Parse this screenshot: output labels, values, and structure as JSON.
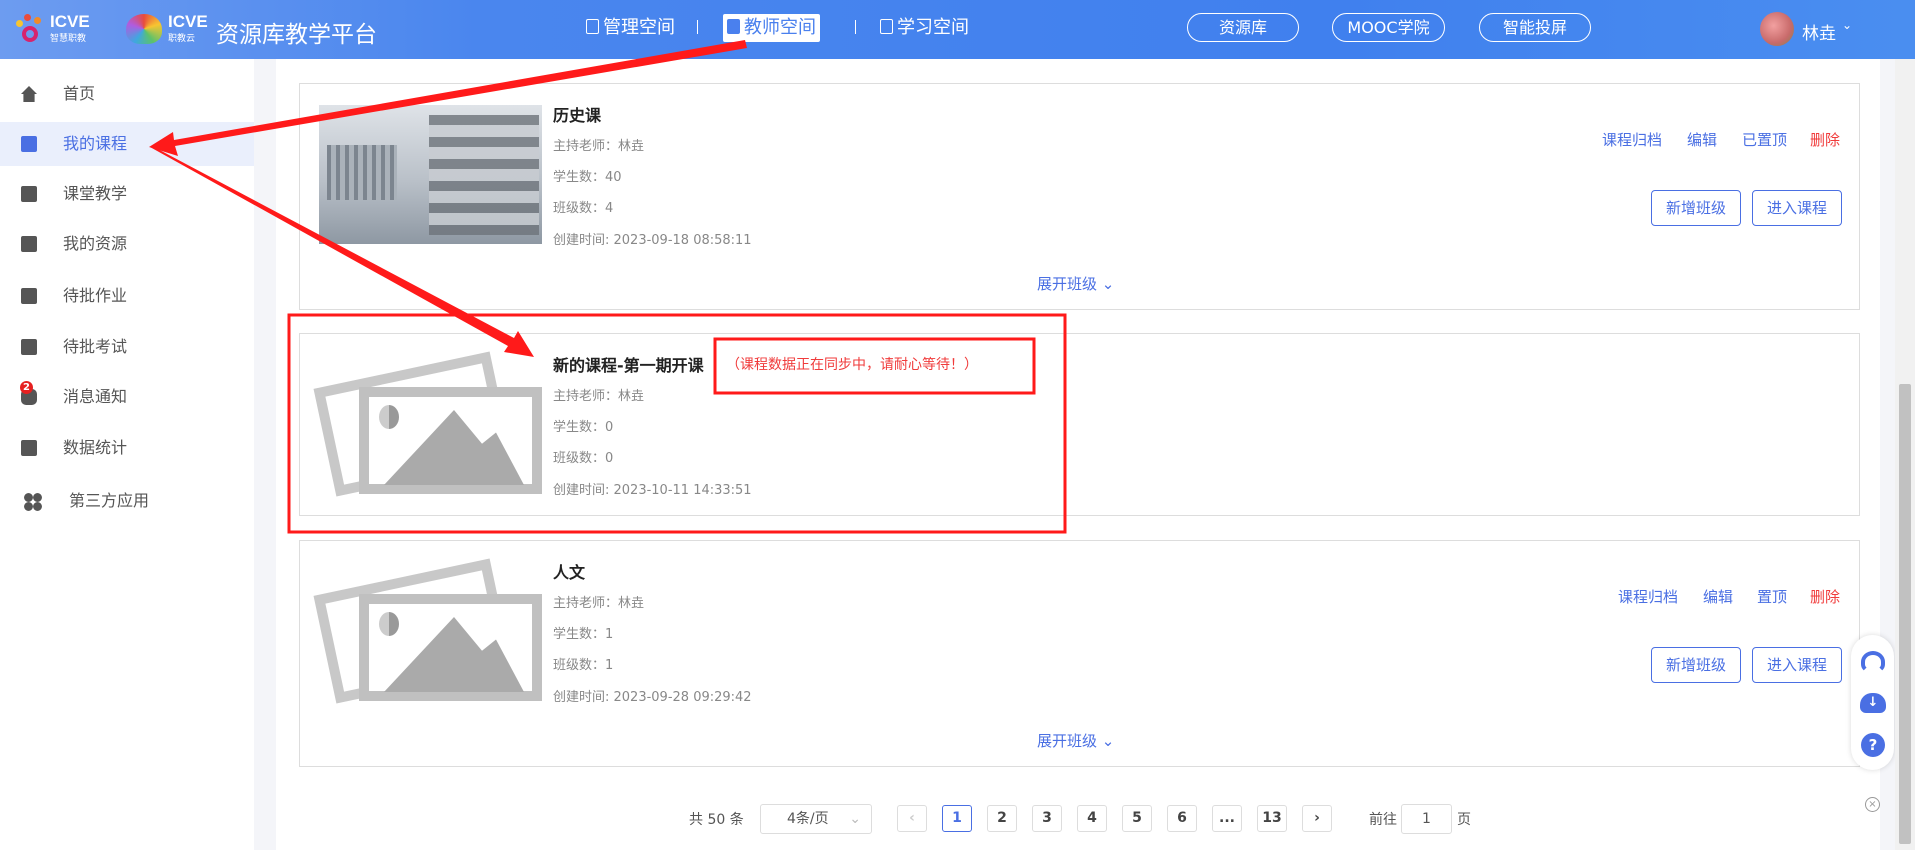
{
  "header": {
    "logo1_text": "ICVE",
    "logo1_sub": "智慧职教",
    "logo2_text": "ICVE",
    "logo2_sub": "职教云",
    "title": "资源库教学平台",
    "nav": [
      {
        "label": "管理空间"
      },
      {
        "label": "教师空间",
        "active": true
      },
      {
        "label": "学习空间"
      }
    ],
    "buttons": [
      "资源库",
      "MOOC学院",
      "智能投屏"
    ],
    "user": "林垚"
  },
  "sidebar": {
    "items": [
      {
        "label": "首页",
        "icon": "home-icon"
      },
      {
        "label": "我的课程",
        "icon": "book-icon",
        "active": true
      },
      {
        "label": "课堂教学",
        "icon": "play-icon"
      },
      {
        "label": "我的资源",
        "icon": "library-icon"
      },
      {
        "label": "待批作业",
        "icon": "homework-icon"
      },
      {
        "label": "待批考试",
        "icon": "exam-icon"
      },
      {
        "label": "消息通知",
        "icon": "message-icon",
        "badge": "2"
      },
      {
        "label": "数据统计",
        "icon": "stats-icon"
      },
      {
        "label": "第三方应用",
        "icon": "apps-icon"
      }
    ]
  },
  "courses": [
    {
      "title": "历史课",
      "teacher": "主持老师：林垚",
      "students": "学生数：40",
      "classes": "班级数：4",
      "created": "创建时间: 2023-09-18 08:58:11",
      "actions": [
        "课程归档",
        "编辑",
        "已置顶",
        "删除"
      ],
      "buttons": [
        "新增班级",
        "进入课程"
      ],
      "expand": "展开班级"
    },
    {
      "title": "新的课程-第一期开课",
      "notice": "（课程数据正在同步中，请耐心等待！）",
      "teacher": "主持老师：林垚",
      "students": "学生数：0",
      "classes": "班级数：0",
      "created": "创建时间: 2023-10-11 14:33:51"
    },
    {
      "title": "人文",
      "teacher": "主持老师：林垚",
      "students": "学生数：1",
      "classes": "班级数：1",
      "created": "创建时间: 2023-09-28 09:29:42",
      "actions": [
        "课程归档",
        "编辑",
        "置顶",
        "删除"
      ],
      "buttons": [
        "新增班级",
        "进入课程"
      ],
      "expand": "展开班级"
    }
  ],
  "pagination": {
    "total": "共 50 条",
    "page_size": "4条/页",
    "pages": [
      "1",
      "2",
      "3",
      "4",
      "5",
      "6",
      "...",
      "13"
    ],
    "current": "1",
    "goto_label": "前往",
    "goto_value": "1",
    "goto_suffix": "页"
  },
  "colors": {
    "accent": "#4a6fe3",
    "danger": "#f03b3b",
    "header": "#4080ee",
    "annotation": "#ff1a1a"
  }
}
